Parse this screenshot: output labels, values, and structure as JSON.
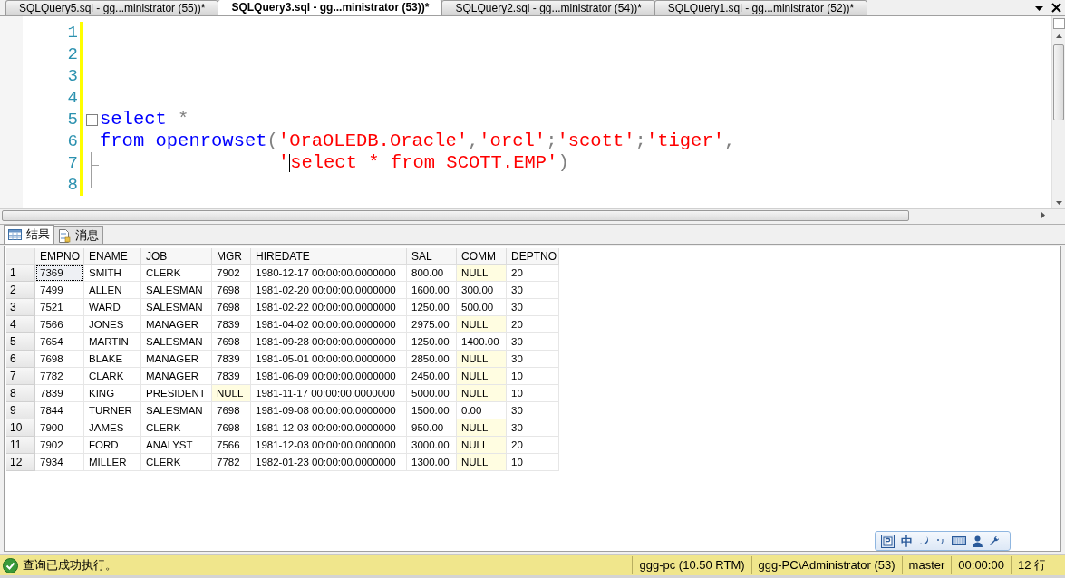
{
  "editor_tabs": [
    {
      "label": "SQLQuery5.sql - gg...ministrator (55))*",
      "selected": false
    },
    {
      "label": "SQLQuery3.sql - gg...ministrator (53))*",
      "selected": true
    },
    {
      "label": "SQLQuery2.sql - gg...ministrator (54))*",
      "selected": false
    },
    {
      "label": "SQLQuery1.sql - gg...ministrator (52))*",
      "selected": false
    }
  ],
  "code_lines": [
    {
      "number": "1"
    },
    {
      "number": "2"
    },
    {
      "number": "3"
    },
    {
      "number": "4"
    },
    {
      "number": "5",
      "kind": "fold-start",
      "tokens": [
        {
          "kind": "keyword",
          "text": "select"
        },
        {
          "kind": "operator",
          "text": "*",
          "space_before": true
        }
      ]
    },
    {
      "number": "6",
      "kind": "fold-middle",
      "tokens": [
        {
          "kind": "keyword",
          "text": "from"
        },
        {
          "kind": "keyword",
          "text": "openrowset",
          "space_before": true
        },
        {
          "kind": "operator",
          "text": "("
        },
        {
          "kind": "string",
          "text": "'OraOLEDB.Oracle'"
        },
        {
          "kind": "operator",
          "text": ","
        },
        {
          "kind": "string",
          "text": "'orcl'"
        },
        {
          "kind": "operator",
          "text": ";"
        },
        {
          "kind": "string",
          "text": "'scott'"
        },
        {
          "kind": "operator",
          "text": ";"
        },
        {
          "kind": "string",
          "text": "'tiger'"
        },
        {
          "kind": "operator",
          "text": ","
        }
      ]
    },
    {
      "number": "7",
      "kind": "fold-branch",
      "indented": true,
      "tokens": [
        {
          "kind": "string",
          "text": "'"
        },
        {
          "kind": "caret"
        },
        {
          "kind": "string",
          "text": "select * from SCOTT.EMP'"
        },
        {
          "kind": "operator",
          "text": ")"
        }
      ]
    },
    {
      "number": "8",
      "kind": "fold-end"
    }
  ],
  "result_tabs": [
    {
      "label": "结果",
      "kind": "grid",
      "selected": true
    },
    {
      "label": "消息",
      "kind": "messages",
      "selected": false
    }
  ],
  "table": {
    "columns": [
      "EMPNO",
      "ENAME",
      "JOB",
      "MGR",
      "HIREDATE",
      "SAL",
      "COMM",
      "DEPTNO"
    ],
    "rows": [
      {
        "number": "1",
        "cells": [
          {
            "text": "7369",
            "focused": true
          },
          "SMITH",
          "CLERK",
          "7902",
          "1980-12-17 00:00:00.0000000",
          "800.00",
          {
            "text": "NULL",
            "null": true
          },
          "20"
        ]
      },
      {
        "number": "2",
        "cells": [
          "7499",
          "ALLEN",
          "SALESMAN",
          "7698",
          "1981-02-20 00:00:00.0000000",
          "1600.00",
          "300.00",
          "30"
        ]
      },
      {
        "number": "3",
        "cells": [
          "7521",
          "WARD",
          "SALESMAN",
          "7698",
          "1981-02-22 00:00:00.0000000",
          "1250.00",
          "500.00",
          "30"
        ]
      },
      {
        "number": "4",
        "cells": [
          "7566",
          "JONES",
          "MANAGER",
          "7839",
          "1981-04-02 00:00:00.0000000",
          "2975.00",
          {
            "text": "NULL",
            "null": true
          },
          "20"
        ]
      },
      {
        "number": "5",
        "cells": [
          "7654",
          "MARTIN",
          "SALESMAN",
          "7698",
          "1981-09-28 00:00:00.0000000",
          "1250.00",
          "1400.00",
          "30"
        ]
      },
      {
        "number": "6",
        "cells": [
          "7698",
          "BLAKE",
          "MANAGER",
          "7839",
          "1981-05-01 00:00:00.0000000",
          "2850.00",
          {
            "text": "NULL",
            "null": true
          },
          "30"
        ]
      },
      {
        "number": "7",
        "cells": [
          "7782",
          "CLARK",
          "MANAGER",
          "7839",
          "1981-06-09 00:00:00.0000000",
          "2450.00",
          {
            "text": "NULL",
            "null": true
          },
          "10"
        ]
      },
      {
        "number": "8",
        "cells": [
          "7839",
          "KING",
          "PRESIDENT",
          {
            "text": "NULL",
            "null": true
          },
          "1981-11-17 00:00:00.0000000",
          "5000.00",
          {
            "text": "NULL",
            "null": true
          },
          "10"
        ]
      },
      {
        "number": "9",
        "cells": [
          "7844",
          "TURNER",
          "SALESMAN",
          "7698",
          "1981-09-08 00:00:00.0000000",
          "1500.00",
          "0.00",
          "30"
        ]
      },
      {
        "number": "10",
        "cells": [
          "7900",
          "JAMES",
          "CLERK",
          "7698",
          "1981-12-03 00:00:00.0000000",
          "950.00",
          {
            "text": "NULL",
            "null": true
          },
          "30"
        ]
      },
      {
        "number": "11",
        "cells": [
          "7902",
          "FORD",
          "ANALYST",
          "7566",
          "1981-12-03 00:00:00.0000000",
          "3000.00",
          {
            "text": "NULL",
            "null": true
          },
          "20"
        ]
      },
      {
        "number": "12",
        "cells": [
          "7934",
          "MILLER",
          "CLERK",
          "7782",
          "1982-01-23 00:00:00.0000000",
          "1300.00",
          {
            "text": "NULL",
            "null": true
          },
          "10"
        ]
      }
    ]
  },
  "ime_toolbar": {
    "mode": "中"
  },
  "status_bar": {
    "message": "查询已成功执行。",
    "sections": [
      "ggg-pc (10.50 RTM)",
      "ggg-PC\\Administrator (53)",
      "master",
      "00:00:00",
      "12 行"
    ]
  }
}
